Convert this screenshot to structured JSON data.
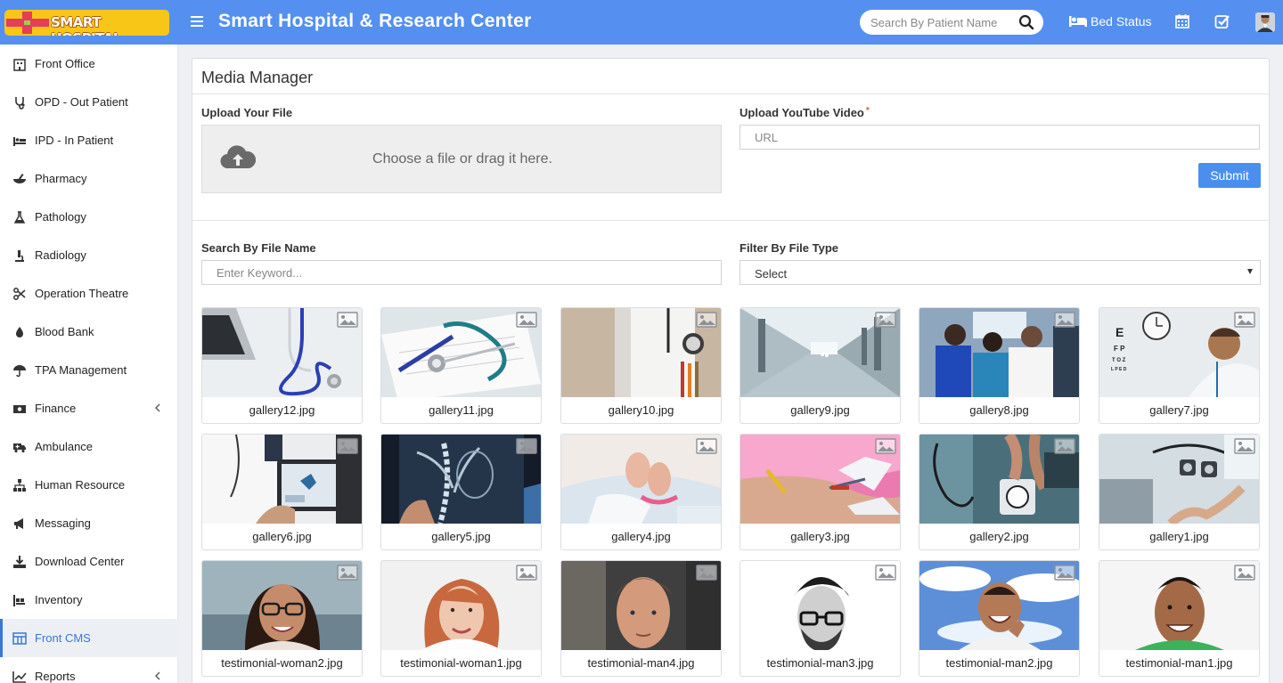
{
  "header": {
    "logo_text": "SMART HOSPITAL",
    "app_title": "Smart Hospital & Research Center",
    "search_placeholder": "Search By Patient Name",
    "bed_status_label": "Bed Status",
    "accent_color": "#5590f0"
  },
  "sidebar": {
    "items": [
      {
        "label": "Front Office",
        "icon": "building-icon"
      },
      {
        "label": "OPD - Out Patient",
        "icon": "stethoscope-icon"
      },
      {
        "label": "IPD - In Patient",
        "icon": "bed-icon"
      },
      {
        "label": "Pharmacy",
        "icon": "mortar-pestle-icon"
      },
      {
        "label": "Pathology",
        "icon": "flask-icon"
      },
      {
        "label": "Radiology",
        "icon": "microscope-icon"
      },
      {
        "label": "Operation Theatre",
        "icon": "scissors-icon"
      },
      {
        "label": "Blood Bank",
        "icon": "tint-icon"
      },
      {
        "label": "TPA Management",
        "icon": "umbrella-icon"
      },
      {
        "label": "Finance",
        "icon": "money-icon"
      },
      {
        "label": "Ambulance",
        "icon": "ambulance-icon"
      },
      {
        "label": "Human Resource",
        "icon": "sitemap-icon"
      },
      {
        "label": "Messaging",
        "icon": "bullhorn-icon"
      },
      {
        "label": "Download Center",
        "icon": "download-icon"
      },
      {
        "label": "Inventory",
        "icon": "inventory-icon"
      },
      {
        "label": "Front CMS",
        "icon": "cms-icon"
      },
      {
        "label": "Reports",
        "icon": "chart-icon"
      }
    ],
    "active_item": "Front CMS"
  },
  "main": {
    "title": "Media Manager",
    "upload_file_label": "Upload Your File",
    "dropzone_text": "Choose a file or drag it here.",
    "youtube_label": "Upload YouTube Video",
    "youtube_required_mark": "*",
    "url_placeholder": "URL",
    "submit_label": "Submit",
    "search_label": "Search By File Name",
    "search_placeholder": "Enter Keyword...",
    "filter_label": "Filter By File Type",
    "filter_value": "Select"
  },
  "gallery": {
    "files": [
      "gallery12.jpg",
      "gallery11.jpg",
      "gallery10.jpg",
      "gallery9.jpg",
      "gallery8.jpg",
      "gallery7.jpg",
      "gallery6.jpg",
      "gallery5.jpg",
      "gallery4.jpg",
      "gallery3.jpg",
      "gallery2.jpg",
      "gallery1.jpg",
      "testimonial-woman2.jpg",
      "testimonial-woman1.jpg",
      "testimonial-man4.jpg",
      "testimonial-man3.jpg",
      "testimonial-man2.jpg",
      "testimonial-man1.jpg"
    ]
  }
}
